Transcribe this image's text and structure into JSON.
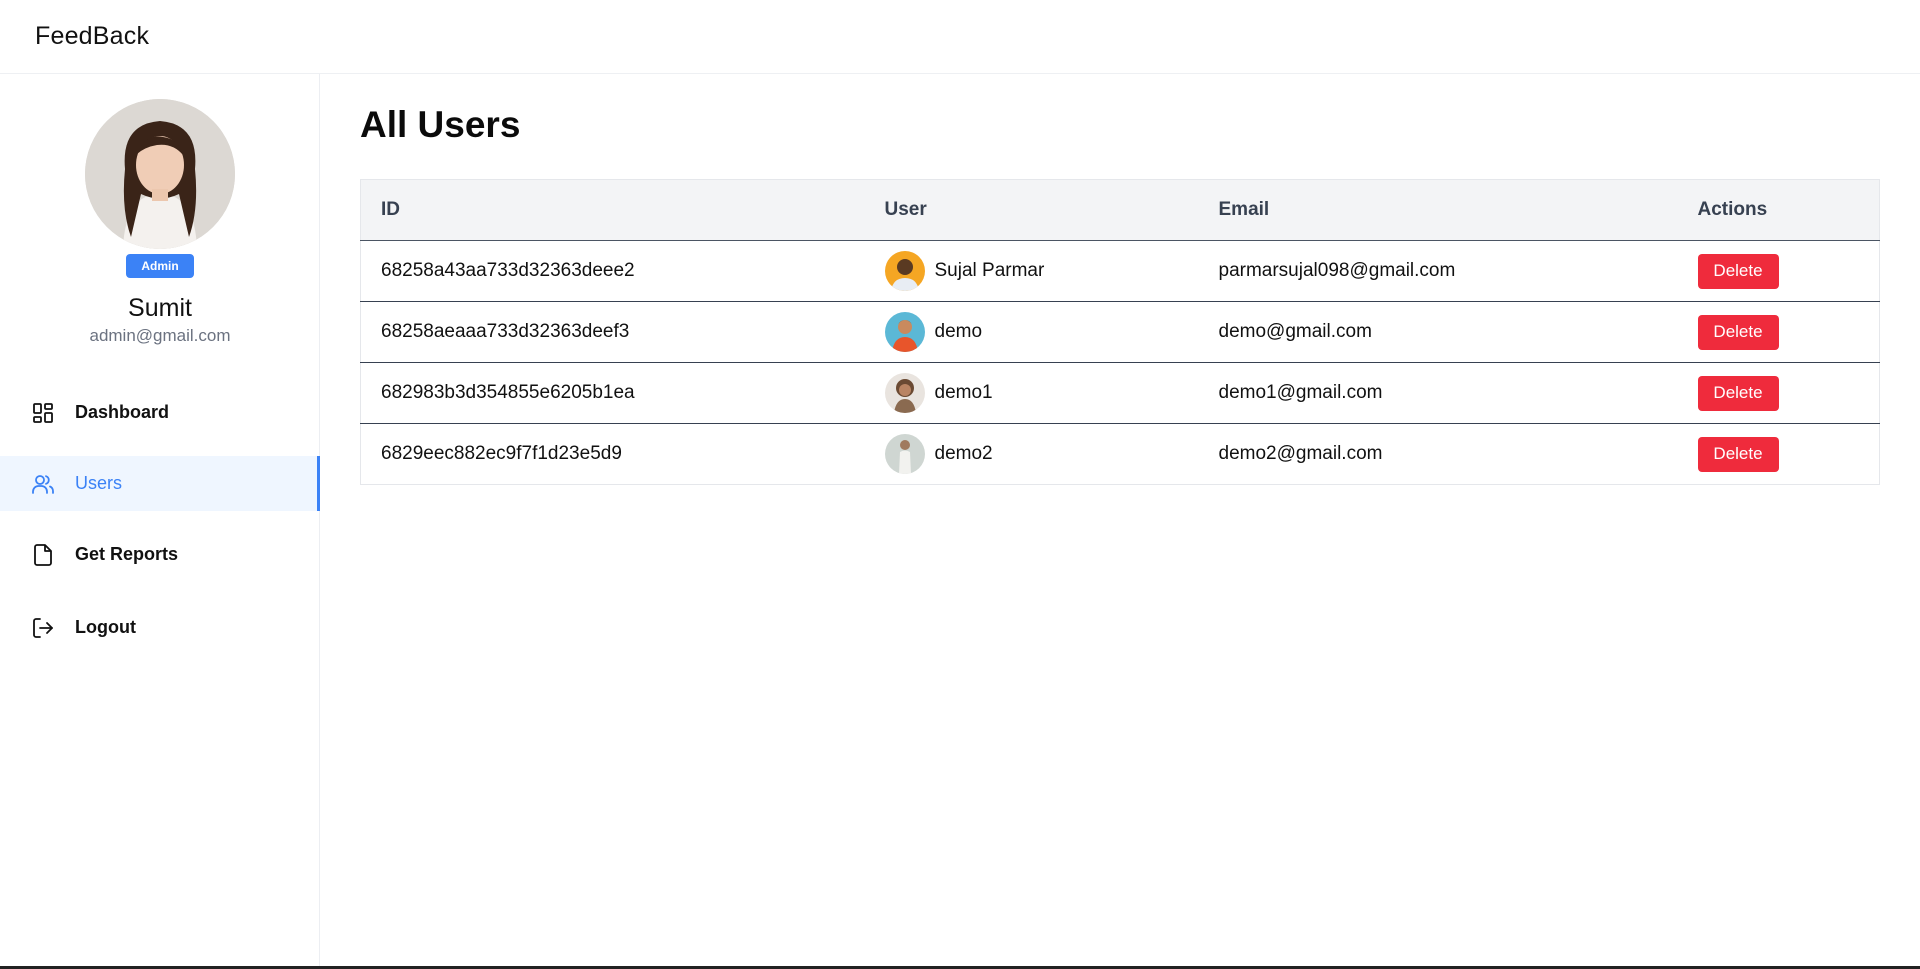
{
  "app": {
    "brand": "FeedBack"
  },
  "profile": {
    "role": "Admin",
    "name": "Sumit",
    "email": "admin@gmail.com"
  },
  "sidebar": {
    "items": [
      {
        "label": "Dashboard",
        "icon": "dashboard-grid-icon",
        "active": false
      },
      {
        "label": "Users",
        "icon": "users-icon",
        "active": true
      },
      {
        "label": "Get Reports",
        "icon": "document-icon",
        "active": false
      },
      {
        "label": "Logout",
        "icon": "logout-icon",
        "active": false
      }
    ]
  },
  "main": {
    "title": "All Users",
    "table": {
      "headers": [
        "ID",
        "User",
        "Email",
        "Actions"
      ],
      "rows": [
        {
          "id": "68258a43aa733d32363deee2",
          "user": "Sujal Parmar",
          "email": "parmarsujal098@gmail.com",
          "action": "Delete"
        },
        {
          "id": "68258aeaaa733d32363deef3",
          "user": "demo",
          "email": "demo@gmail.com",
          "action": "Delete"
        },
        {
          "id": "682983b3d354855e6205b1ea",
          "user": "demo1",
          "email": "demo1@gmail.com",
          "action": "Delete"
        },
        {
          "id": "6829eec882ec9f7f1d23e5d9",
          "user": "demo2",
          "email": "demo2@gmail.com",
          "action": "Delete"
        }
      ]
    }
  },
  "colors": {
    "accent": "#3b82f6",
    "danger": "#ef2b3c",
    "active_bg": "#eff6ff"
  }
}
